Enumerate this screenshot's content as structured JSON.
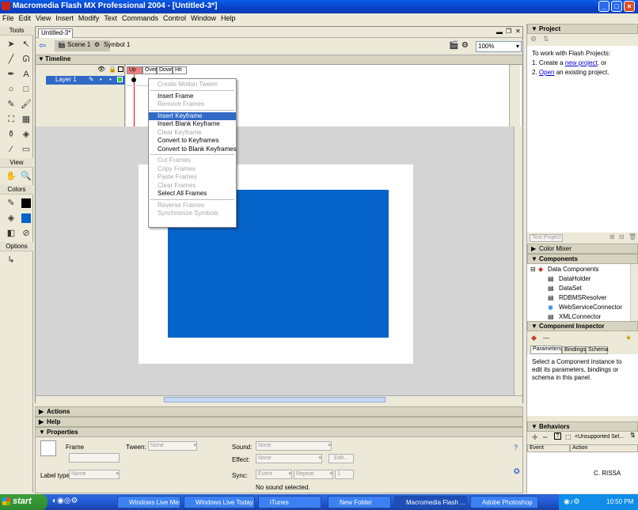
{
  "window": {
    "title": "Macromedia Flash MX Professional 2004 - [Untitled-3*]"
  },
  "menu": [
    "File",
    "Edit",
    "View",
    "Insert",
    "Modify",
    "Text",
    "Commands",
    "Control",
    "Window",
    "Help"
  ],
  "tools": {
    "label": "Tools",
    "view_label": "View",
    "colors_label": "Colors",
    "options_label": "Options"
  },
  "document": {
    "tab": "Untitled-3*",
    "scene": "Scene 1",
    "symbol": "Symbol 1",
    "zoom": "100%",
    "timeline_label": "Timeline",
    "layer_name": "Layer 1",
    "frame_labels": [
      "Up",
      "Over",
      "Down",
      "Hit"
    ]
  },
  "context_menu": {
    "groups": [
      [
        "Create Motion Tween"
      ],
      [
        "Insert Frame",
        "Remove Frames"
      ],
      [
        "Insert Keyframe",
        "Insert Blank Keyframe",
        "Clear Keyframe",
        "Convert to Keyframes",
        "Convert to Blank Keyframes"
      ],
      [
        "Cut Frames",
        "Copy Frames",
        "Paste Frames",
        "Clear Frames",
        "Select All Frames"
      ],
      [
        "Reverse Frames",
        "Synchronize Symbols"
      ]
    ],
    "disabled": [
      "Create Motion Tween",
      "Remove Frames",
      "Clear Keyframe",
      "Cut Frames",
      "Copy Frames",
      "Paste Frames",
      "Clear Frames",
      "Reverse Frames",
      "Synchronize Symbols"
    ],
    "selected": "Insert Keyframe"
  },
  "panels": {
    "actions": "Actions",
    "help": "Help",
    "properties": "Properties",
    "frame_label": "Frame",
    "tween_label": "Tween:",
    "tween_value": "None",
    "sound_label": "Sound:",
    "sound_value": "None",
    "effect_label": "Effect:",
    "effect_value": "None",
    "edit_button": "Edit...",
    "label_type": "Label type:",
    "label_type_value": "Name",
    "sync_label": "Sync:",
    "sync_value": "Event",
    "repeat_value": "Repeat",
    "repeat_count": "1",
    "no_sound": "No sound selected."
  },
  "right": {
    "project_title": "Project",
    "project_text1": "To work with Flash Projects:",
    "project_create_prefix": "1. Create a ",
    "project_create_link": "new project",
    "project_create_suffix": ", or",
    "project_open_prefix": "2. ",
    "project_open_link": "Open",
    "project_open_suffix": " an existing project.",
    "test_project": "Test Project",
    "color_mixer": "Color Mixer",
    "components": "Components",
    "component_items": [
      "Data Components",
      "DataHolder",
      "DataSet",
      "RDBMSResolver",
      "WebServiceConnector",
      "XMLConnector"
    ],
    "component_inspector": "Component Inspector",
    "inspector_value": "---",
    "inspector_tabs": [
      "Parameters",
      "Bindings",
      "Schema"
    ],
    "inspector_text": "Select a Component instance to edit its parameters, bindings or schema in this panel.",
    "behaviors": "Behaviors",
    "behaviors_selection": "<Unsupported Sel...",
    "behaviors_cols": [
      "Event",
      "Action"
    ],
    "watermark": "C. RISSA"
  },
  "taskbar": {
    "start": "start",
    "items": [
      "Windows Live Mes...",
      "Windows Live Today",
      "iTunes",
      "New Folder",
      "Macromedia Flash ...",
      "Adobe Photoshop"
    ],
    "active": "Macromedia Flash ...",
    "time": "10:50 PM"
  }
}
